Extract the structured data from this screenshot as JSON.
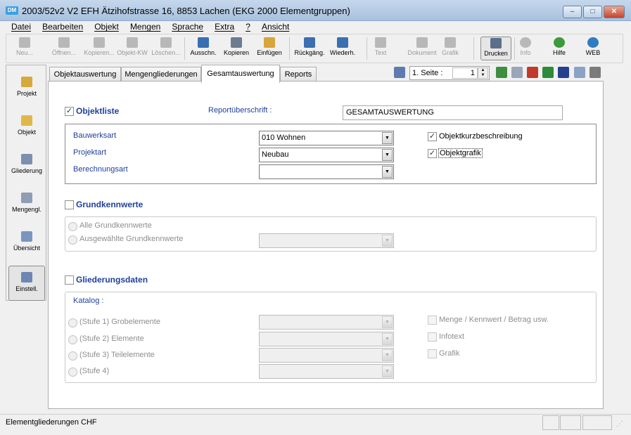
{
  "window": {
    "icon_text": "DM",
    "title": "2003/52v2 V2 EFH Ätzihofstrasse 16, 8853 Lachen (EKG 2000 Elementgruppen)",
    "min": "–",
    "max": "□",
    "close": "✕"
  },
  "menu": [
    "Datei",
    "Bearbeiten",
    "Objekt",
    "Mengen",
    "Sprache",
    "Extra",
    "?",
    "Ansicht"
  ],
  "toolbar": {
    "neu": "Neu...",
    "oeffnen": "Öffnen...",
    "kopieren_obj": "Kopieren...",
    "objekt_kw": "Objekt-KW",
    "loeschen": "Löschen...",
    "ausschn": "Ausschn.",
    "kopieren": "Kopieren",
    "einfuegen": "Einfügen",
    "rueckgaeng": "Rückgäng.",
    "wiederh": "Wiederh.",
    "text": "Text",
    "dokument": "Dokument",
    "grafik": "Grafik",
    "drucken": "Drucken",
    "info": "Info",
    "hilfe": "Hilfe",
    "web": "WEB"
  },
  "sidebar": [
    "Projekt",
    "Objekt",
    "Gliederung",
    "Mengengl.",
    "Übersicht",
    "Einstell."
  ],
  "tabs": [
    "Objektauswertung",
    "Mengengliederungen",
    "Gesamtauswertung",
    "Reports"
  ],
  "seite": {
    "label": "1. Seite :",
    "value": "1"
  },
  "objektliste": {
    "label": "Objektliste",
    "checked": true,
    "report_label": "Reportüberschrift :",
    "report_value": "GESAMTAUSWERTUNG",
    "bauwerksart_label": "Bauwerksart",
    "bauwerksart_value": "010 Wohnen",
    "projektart_label": "Projektart",
    "projektart_value": "Neubau",
    "berechnungsart_label": "Berechnungsart",
    "berechnungsart_value": "",
    "kurzbeschreibung": "Objektkurzbeschreibung",
    "grafik": "Objektgrafik"
  },
  "grundkennwerte": {
    "label": "Grundkennwerte",
    "alle": "Alle Grundkennwerte",
    "ausgewaehlte": "Ausgewählte Grundkennwerte"
  },
  "gliederungsdaten": {
    "label": "Gliederungsdaten",
    "katalog": "Katalog :",
    "stufe1": "(Stufe 1) Grobelemente",
    "stufe2": "(Stufe 2) Elemente",
    "stufe3": "(Stufe 3) Teilelemente",
    "stufe4": "(Stufe 4)",
    "menge": "Menge / Kennwert / Betrag usw.",
    "infotext": "Infotext",
    "grafik": "Grafik"
  },
  "status": {
    "text": "Elementgliederungen CHF"
  },
  "colors": {
    "label_blue": "#1f3f9c",
    "titlebar": "#b7cce6"
  }
}
